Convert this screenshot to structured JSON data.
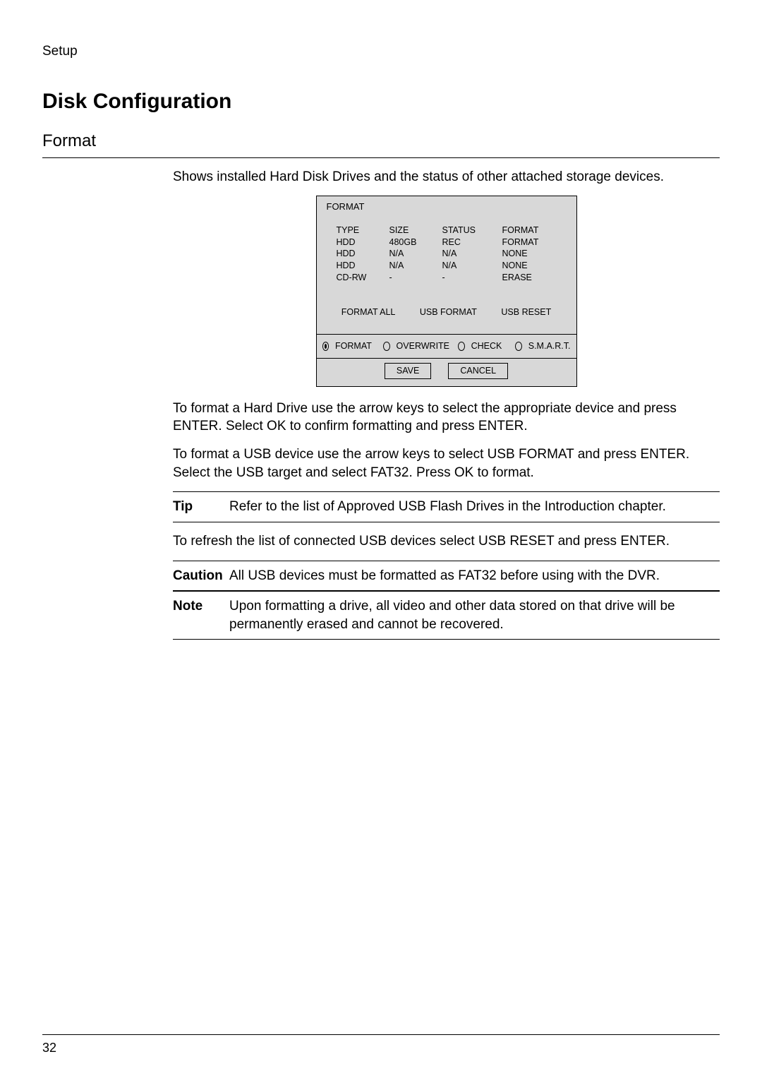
{
  "page": {
    "header": "Setup",
    "h1": "Disk Configuration",
    "h2": "Format",
    "page_number": "32"
  },
  "intro": "Shows installed Hard Disk Drives and the status of other attached storage devices.",
  "figure": {
    "title": "FORMAT",
    "headers": {
      "c1": "TYPE",
      "c2": "SIZE",
      "c3": "STATUS",
      "c4": "FORMAT"
    },
    "rows": [
      {
        "c1": "HDD",
        "c2": "480GB",
        "c3": "REC",
        "c4": "FORMAT"
      },
      {
        "c1": "HDD",
        "c2": "N/A",
        "c3": "N/A",
        "c4": "NONE"
      },
      {
        "c1": "HDD",
        "c2": "N/A",
        "c3": "N/A",
        "c4": "NONE"
      },
      {
        "c1": "CD-RW",
        "c2": "-",
        "c3": "-",
        "c4": "ERASE"
      }
    ],
    "buttons": {
      "all": "FORMAT ALL",
      "usb": "USB FORMAT",
      "reset": "USB RESET"
    },
    "tabs": {
      "format": "FORMAT",
      "overwrite": "OVERWRITE",
      "check": "CHECK",
      "smart": "S.M.A.R.T."
    },
    "save": "SAVE",
    "cancel": "CANCEL"
  },
  "para1": "To format a Hard Drive use the arrow keys to select the appropriate device and press ENTER. Select OK to confirm formatting and press ENTER.",
  "para2": "To format a USB device use the arrow keys to select USB FORMAT and press ENTER. Select the USB target and select FAT32. Press OK to format.",
  "tip": {
    "label": "Tip",
    "text": "Refer to the list of Approved USB Flash Drives in the Introduction chapter."
  },
  "para3": "To refresh the list of connected USB devices select USB RESET and press ENTER.",
  "caution": {
    "label": "Caution",
    "text": "All USB devices must be formatted as FAT32 before using with the DVR."
  },
  "note": {
    "label": "Note",
    "text": "Upon formatting a drive, all video and other data stored on that drive will be permanently erased and cannot be recovered."
  }
}
